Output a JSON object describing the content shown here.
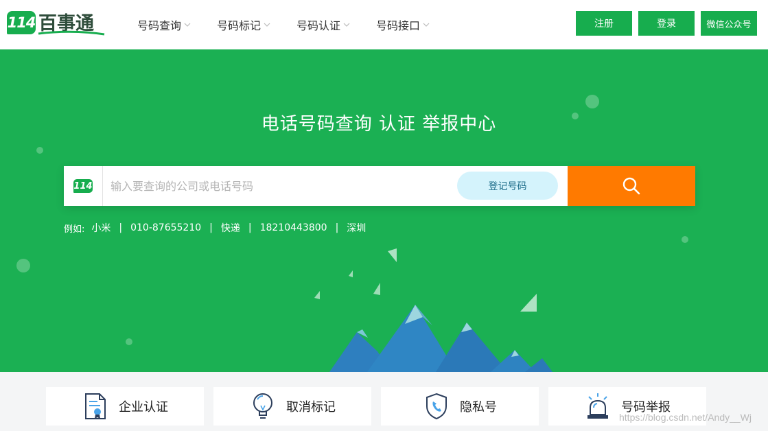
{
  "header": {
    "logo": {
      "badge": "114",
      "text": "百事通"
    },
    "nav": [
      {
        "label": "号码查询"
      },
      {
        "label": "号码标记"
      },
      {
        "label": "号码认证"
      },
      {
        "label": "号码接口"
      }
    ],
    "buttons": {
      "register": "注册",
      "login": "登录",
      "wechat": "微信公众号"
    }
  },
  "hero": {
    "title": "电话号码查询  认证  举报中心",
    "search": {
      "logo_badge": "114",
      "placeholder": "输入要查询的公司或电话号码",
      "register_number_label": "登记号码"
    },
    "examples": {
      "label": "例如:",
      "items": [
        "小米",
        "010-87655210",
        "快递",
        "18210443800",
        "深圳"
      ],
      "separator": "|"
    }
  },
  "features": [
    {
      "label": "企业认证",
      "icon": "certificate-icon"
    },
    {
      "label": "取消标记",
      "icon": "lightbulb-icon"
    },
    {
      "label": "隐私号",
      "icon": "shield-phone-icon"
    },
    {
      "label": "号码举报",
      "icon": "alarm-light-icon"
    }
  ],
  "watermark": "https://blog.csdn.net/Andy__Wj",
  "colors": {
    "brand_green": "#1bb053",
    "search_orange": "#ff7a00",
    "register_pill": "#d4f3fc"
  }
}
